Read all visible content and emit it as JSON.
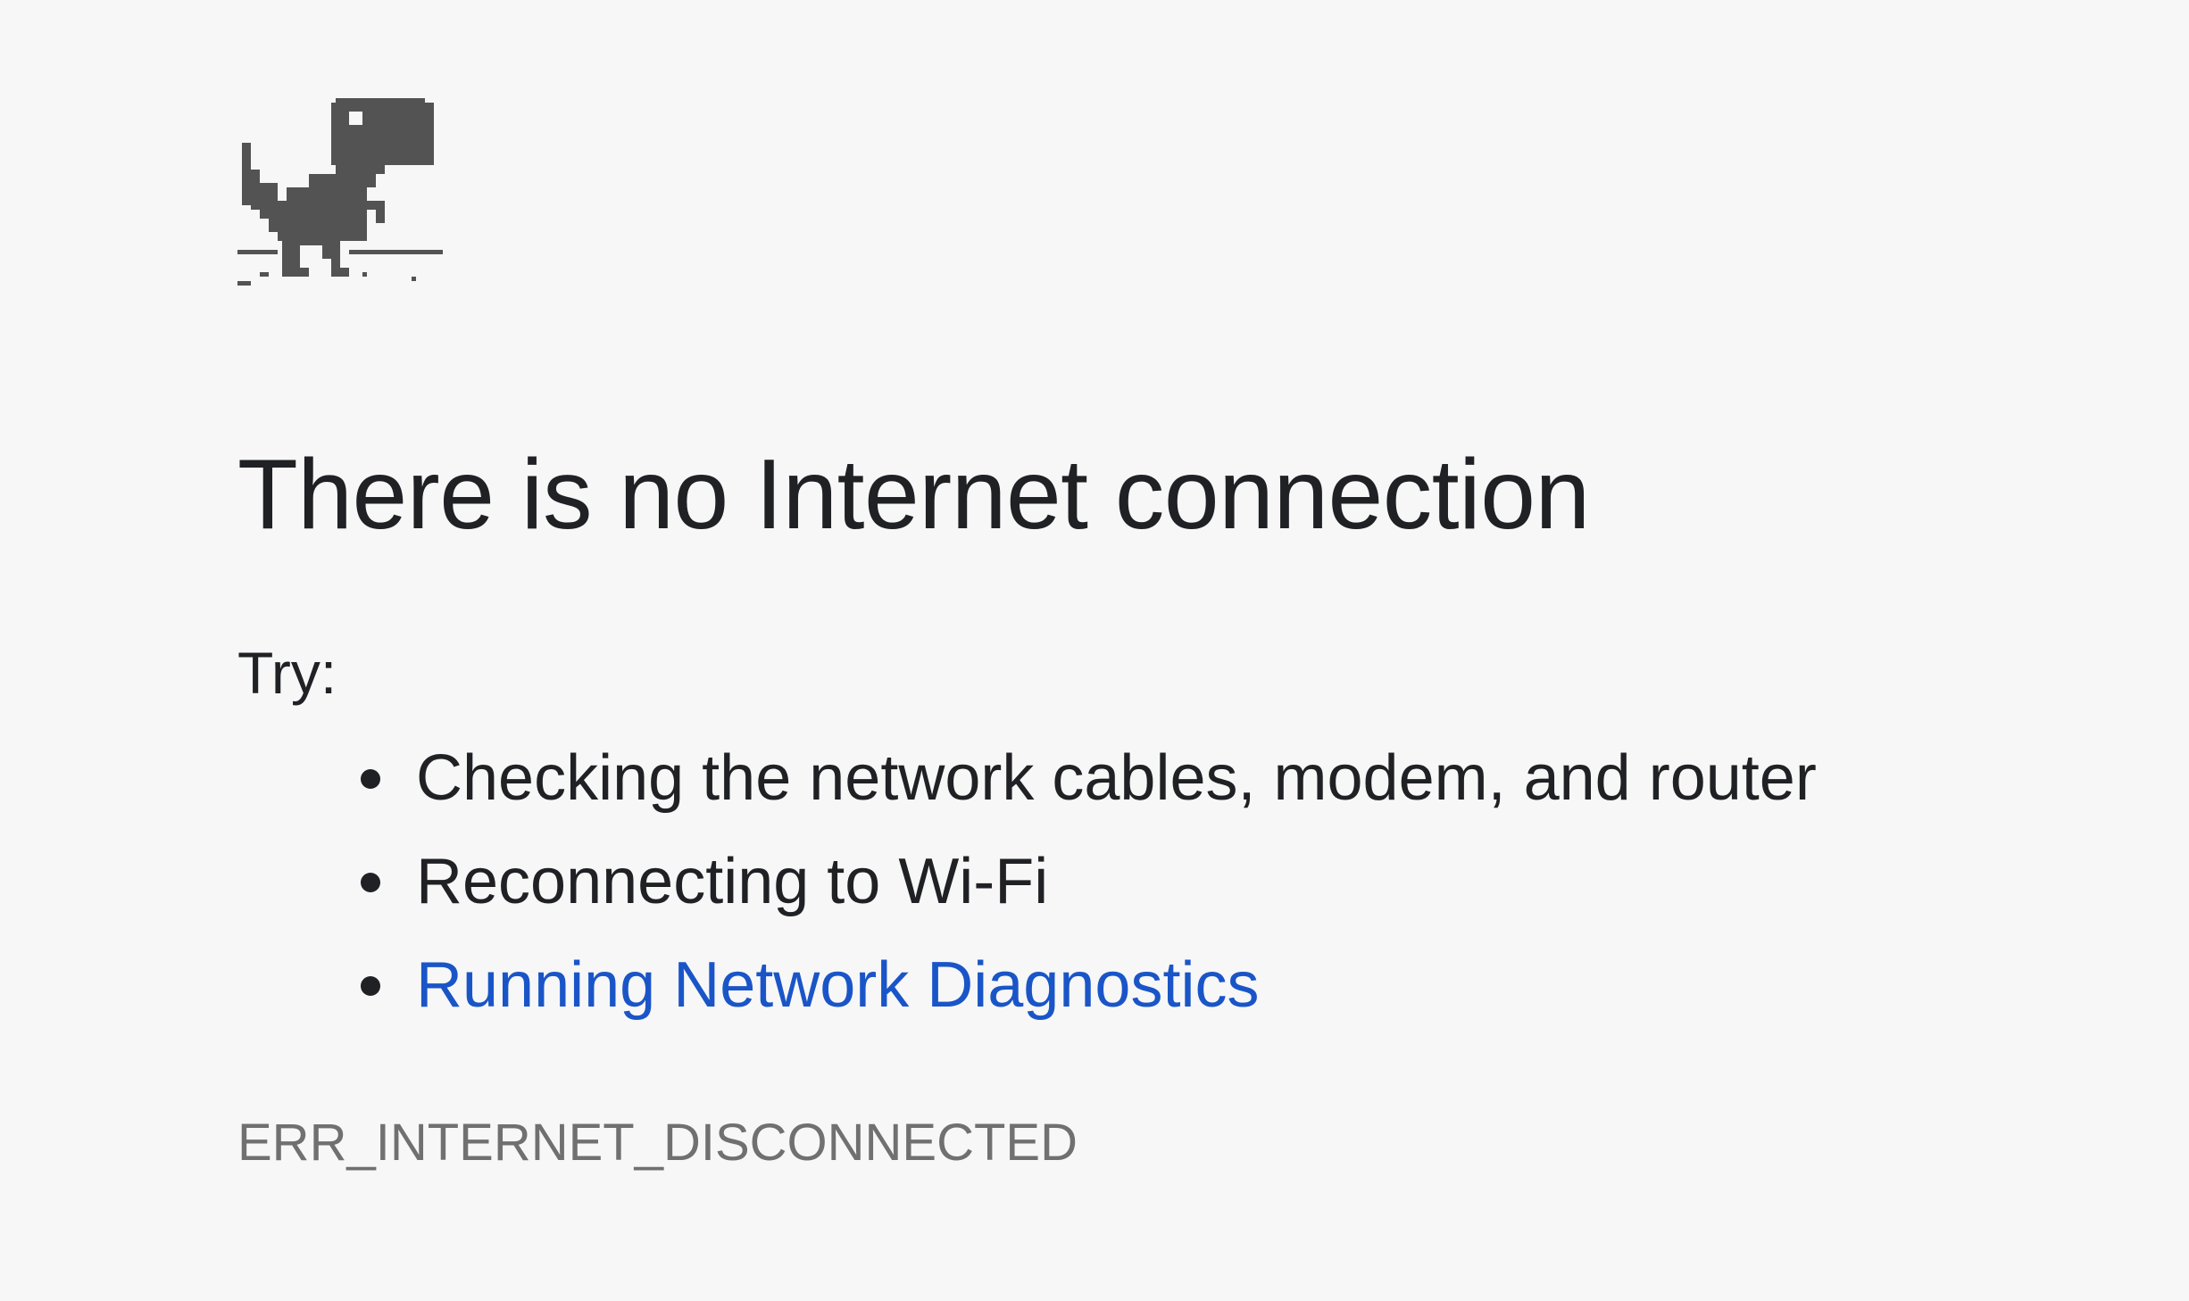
{
  "page": {
    "background": "#f7f7f7"
  },
  "dino": {
    "icon": "offline-dinosaur-icon",
    "color": "#535353"
  },
  "error": {
    "title": "There is no Internet connection",
    "try_label": "Try:",
    "suggestions": [
      {
        "label": "Checking the network cables, modem, and router",
        "is_link": false
      },
      {
        "label": "Reconnecting to Wi-Fi",
        "is_link": false
      },
      {
        "label": "Running Network Diagnostics",
        "is_link": true
      }
    ],
    "code": "ERR_INTERNET_DISCONNECTED"
  },
  "colors": {
    "text": "#202124",
    "link": "#1a55c8",
    "code": "#707070"
  }
}
